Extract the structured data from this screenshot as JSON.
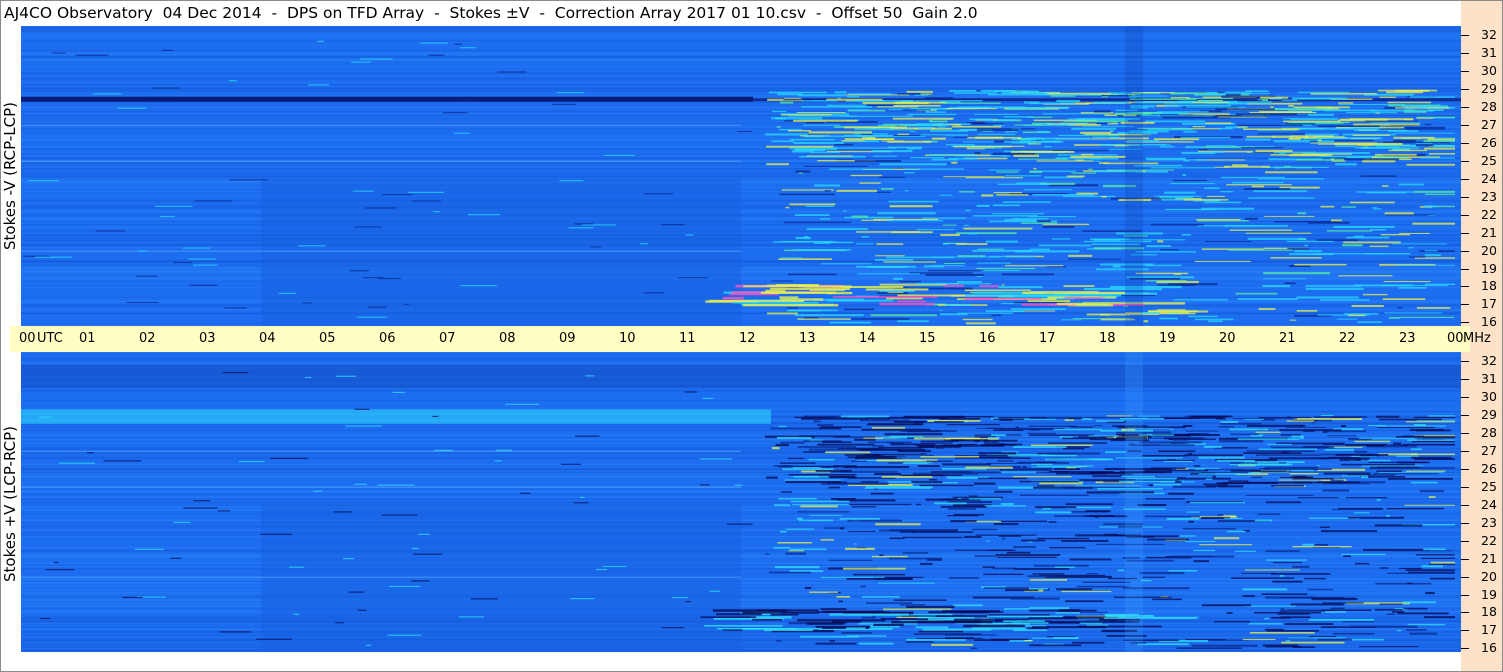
{
  "header": {
    "title": "AJ4CO Observatory  04 Dec 2014  -  DPS on TFD Array  -  Stokes ±V  -  Correction Array 2017 01 10.csv  -  Offset 50  Gain 2.0"
  },
  "chart_data": [
    {
      "type": "heatmap",
      "ylabel": "Stokes -V (RCP-LCP)",
      "x_unit": "UTC",
      "y_unit": "MHz",
      "xlim": [
        0,
        24
      ],
      "ylim": [
        15.8,
        32.5
      ],
      "x_ticks": [
        "00",
        "01",
        "02",
        "03",
        "04",
        "05",
        "06",
        "07",
        "08",
        "09",
        "10",
        "11",
        "12",
        "13",
        "14",
        "15",
        "16",
        "17",
        "18",
        "19",
        "20",
        "21",
        "22",
        "23",
        "00"
      ],
      "y_ticks": [
        "16",
        "17",
        "18",
        "19",
        "20",
        "21",
        "22",
        "23",
        "24",
        "25",
        "26",
        "27",
        "28",
        "29",
        "30",
        "31",
        "32"
      ],
      "colors": {
        "background": "#1d6df0",
        "dark": "#08106a",
        "cyan": "#28d8ff",
        "yellow": "#e8f050",
        "magenta": "#ff50c0"
      }
    },
    {
      "type": "heatmap",
      "ylabel": "Stokes +V (LCP-RCP)",
      "x_unit": "UTC",
      "y_unit": "MHz",
      "xlim": [
        0,
        24
      ],
      "ylim": [
        15.8,
        32.5
      ],
      "x_ticks": [
        "00",
        "01",
        "02",
        "03",
        "04",
        "05",
        "06",
        "07",
        "08",
        "09",
        "10",
        "11",
        "12",
        "13",
        "14",
        "15",
        "16",
        "17",
        "18",
        "19",
        "20",
        "21",
        "22",
        "23",
        "00"
      ],
      "y_ticks": [
        "16",
        "17",
        "18",
        "19",
        "20",
        "21",
        "22",
        "23",
        "24",
        "25",
        "26",
        "27",
        "28",
        "29",
        "30",
        "31",
        "32"
      ],
      "colors": {
        "background": "#1d6df0",
        "dark": "#060a55",
        "cyan": "#30e0ff",
        "yellow": "#e8f050"
      }
    }
  ]
}
